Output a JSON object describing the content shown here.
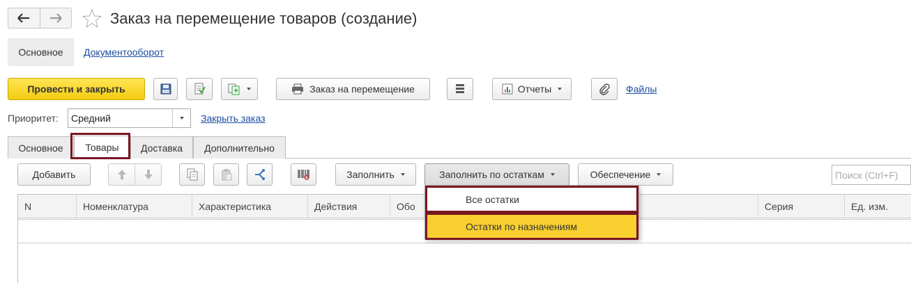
{
  "header": {
    "title": "Заказ на перемещение товаров (создание)",
    "back_icon": "arrow-left-icon",
    "forward_icon": "arrow-right-icon",
    "favorite_icon": "star-icon"
  },
  "sections": {
    "main": "Основное",
    "docflow": "Документооборот"
  },
  "toolbar": {
    "post_close": "Провести и закрыть",
    "move_order": "Заказ на перемещение",
    "reports": "Отчеты",
    "files": "Файлы"
  },
  "priority": {
    "label": "Приоритет:",
    "value": "Средний",
    "close_order": "Закрыть заказ"
  },
  "tabs": [
    "Основное",
    "Товары",
    "Доставка",
    "Дополнительно"
  ],
  "goods_toolbar": {
    "add": "Добавить",
    "fill": "Заполнить",
    "fill_by_stock": "Заполнить по остаткам",
    "provision": "Обеспечение",
    "search_placeholder": "Поиск (Ctrl+F)"
  },
  "table": {
    "columns": [
      "N",
      "Номенклатура",
      "Характеристика",
      "Действия",
      "Обо",
      "",
      "Серия",
      "Ед. изм."
    ]
  },
  "dropdown": {
    "items": [
      "Все остатки",
      "Остатки по назначениям"
    ]
  },
  "colors": {
    "accent_yellow": "#f3cc10",
    "highlight_border": "#7a1622",
    "link": "#1b4da0"
  }
}
